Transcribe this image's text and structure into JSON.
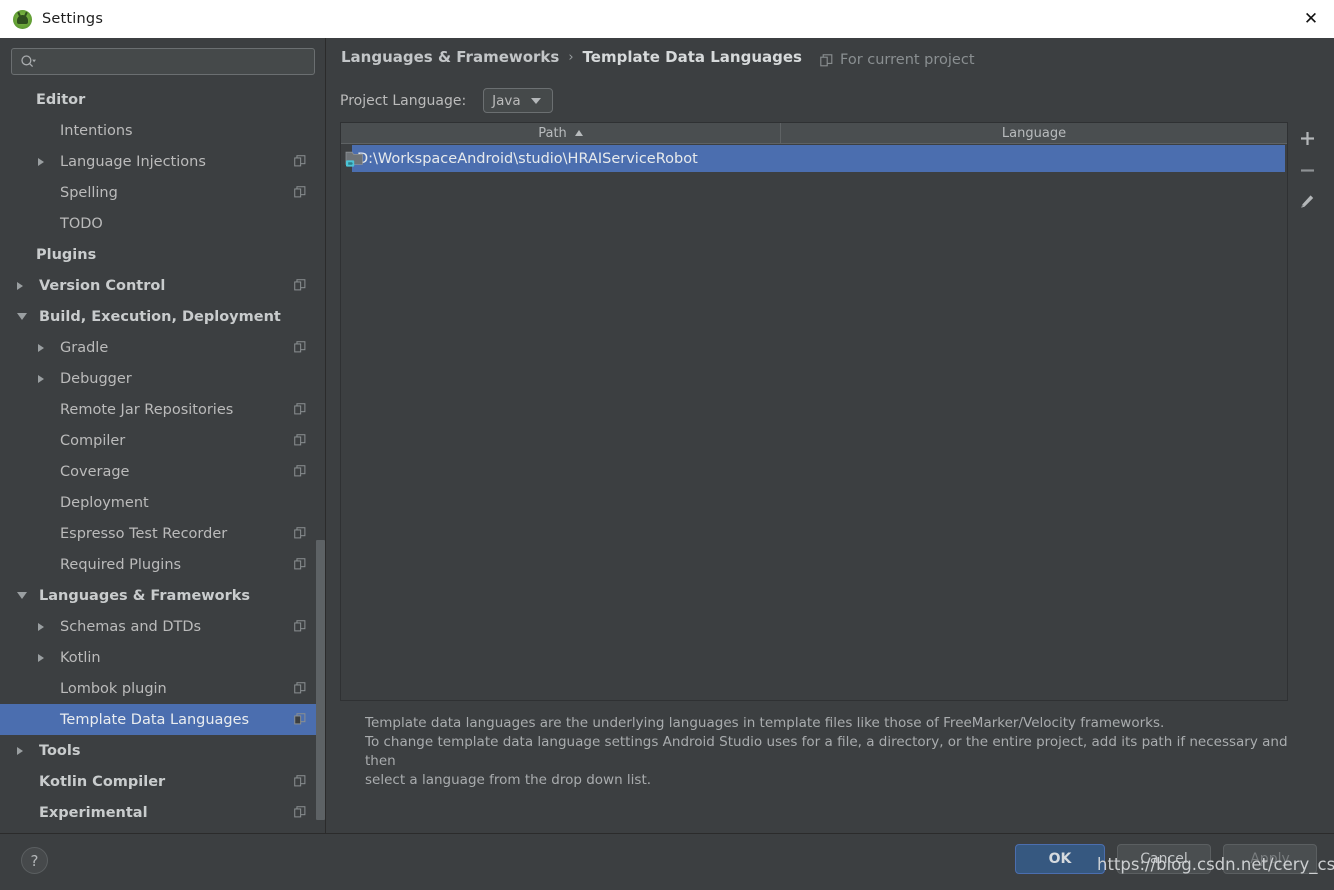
{
  "window": {
    "title": "Settings",
    "app_icon": "android-studio-icon",
    "close_label": "✕"
  },
  "sidebar": {
    "search": {
      "value": "",
      "placeholder": ""
    },
    "items": [
      {
        "label": "Editor",
        "indent": 36,
        "bold": true,
        "twisty": "none",
        "scope": false
      },
      {
        "label": "Intentions",
        "indent": 60,
        "bold": false,
        "twisty": "none",
        "scope": false
      },
      {
        "label": "Language Injections",
        "indent": 60,
        "bold": false,
        "twisty": "collapsed",
        "scope": true
      },
      {
        "label": "Spelling",
        "indent": 60,
        "bold": false,
        "twisty": "none",
        "scope": true
      },
      {
        "label": "TODO",
        "indent": 60,
        "bold": false,
        "twisty": "none",
        "scope": false
      },
      {
        "label": "Plugins",
        "indent": 36,
        "bold": true,
        "twisty": "none",
        "scope": false
      },
      {
        "label": "Version Control",
        "indent": 39,
        "bold": true,
        "twisty": "collapsed",
        "scope": true
      },
      {
        "label": "Build, Execution, Deployment",
        "indent": 39,
        "bold": true,
        "twisty": "expanded",
        "scope": false
      },
      {
        "label": "Gradle",
        "indent": 60,
        "bold": false,
        "twisty": "collapsed",
        "scope": true
      },
      {
        "label": "Debugger",
        "indent": 60,
        "bold": false,
        "twisty": "collapsed",
        "scope": false
      },
      {
        "label": "Remote Jar Repositories",
        "indent": 60,
        "bold": false,
        "twisty": "none",
        "scope": true
      },
      {
        "label": "Compiler",
        "indent": 60,
        "bold": false,
        "twisty": "none",
        "scope": true
      },
      {
        "label": "Coverage",
        "indent": 60,
        "bold": false,
        "twisty": "none",
        "scope": true
      },
      {
        "label": "Deployment",
        "indent": 60,
        "bold": false,
        "twisty": "none",
        "scope": false
      },
      {
        "label": "Espresso Test Recorder",
        "indent": 60,
        "bold": false,
        "twisty": "none",
        "scope": true
      },
      {
        "label": "Required Plugins",
        "indent": 60,
        "bold": false,
        "twisty": "none",
        "scope": true
      },
      {
        "label": "Languages & Frameworks",
        "indent": 39,
        "bold": true,
        "twisty": "expanded",
        "scope": false
      },
      {
        "label": "Schemas and DTDs",
        "indent": 60,
        "bold": false,
        "twisty": "collapsed",
        "scope": true
      },
      {
        "label": "Kotlin",
        "indent": 60,
        "bold": false,
        "twisty": "collapsed",
        "scope": false
      },
      {
        "label": "Lombok plugin",
        "indent": 60,
        "bold": false,
        "twisty": "none",
        "scope": true
      },
      {
        "label": "Template Data Languages",
        "indent": 60,
        "bold": false,
        "twisty": "none",
        "scope": true,
        "selected": true
      },
      {
        "label": "Tools",
        "indent": 39,
        "bold": true,
        "twisty": "collapsed",
        "scope": false
      },
      {
        "label": "Kotlin Compiler",
        "indent": 39,
        "bold": true,
        "twisty": "none",
        "scope": true
      },
      {
        "label": "Experimental",
        "indent": 39,
        "bold": true,
        "twisty": "none",
        "scope": true
      }
    ]
  },
  "content": {
    "breadcrumb": {
      "parent": "Languages & Frameworks",
      "separator": "›",
      "current": "Template Data Languages"
    },
    "for_current_project": "For current project",
    "project_language": {
      "label": "Project Language:",
      "value": "Java",
      "options": [
        "Java"
      ]
    },
    "table": {
      "columns": [
        "Path",
        "Language"
      ],
      "sort_column": "Path",
      "sort_direction": "ascending",
      "rows": [
        {
          "path": "D:\\WorkspaceAndroid\\studio\\HRAIServiceRobot",
          "language": "",
          "icon": "folder-java-icon",
          "selected": true
        }
      ]
    },
    "toolbar": {
      "add": "+",
      "remove": "–",
      "edit": "pencil-icon"
    },
    "description_lines": [
      "Template data languages are the underlying languages in template files like those of FreeMarker/Velocity frameworks.",
      "To change template data language settings Android Studio uses for a file, a directory, or the entire project, add its path if necessary and then",
      "select a language from the drop down list."
    ]
  },
  "footer": {
    "help": "?",
    "ok": "OK",
    "cancel": "Cancel",
    "apply": "Apply"
  },
  "watermark": "https://blog.csdn.net/cery_csdn",
  "colors": {
    "panel_bg": "#3c3f41",
    "titlebar_bg": "#ffffff",
    "selection_blue": "#4b6eaf",
    "ok_button": "#365880",
    "text": "#bbbbbb",
    "header_bg": "#4a4e50"
  }
}
